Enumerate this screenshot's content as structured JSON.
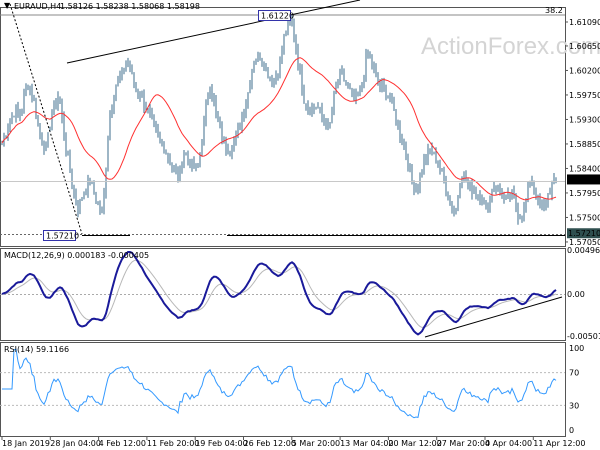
{
  "header": {
    "symbol": "EURAUD,H4",
    "ohlc": "1.58126 1.58238 1.58068 1.58198"
  },
  "watermark": "ActionForex.com",
  "colors": {
    "bars": "#3d6d8c",
    "ma": "#ff3030",
    "macd": "#1a1a9a",
    "signal": "#b8b8b8",
    "rsi": "#3399ff"
  },
  "annotations": {
    "high_label": "1.61220",
    "low_label": "1.57210",
    "fib_label": "38.2"
  },
  "chart_data": [
    {
      "type": "line",
      "title": "EURAUD,H4",
      "subtitle": "price bars with moving average",
      "ylim": [
        1.5695,
        1.613
      ],
      "yticks": [
        "1.61090",
        "1.60650",
        "1.60200",
        "1.59750",
        "1.59300",
        "1.58850",
        "1.58400",
        "1.57950",
        "1.57500",
        "1.57050"
      ],
      "current_price": "1.58198",
      "support_price": "1.57210",
      "close": [
        1.5887,
        1.592,
        1.5947,
        1.5938,
        1.6002,
        1.5966,
        1.5901,
        1.5874,
        1.5947,
        1.5975,
        1.5892,
        1.5819,
        1.5764,
        1.58,
        1.5819,
        1.5782,
        1.5755,
        1.5929,
        1.5993,
        1.6012,
        1.6039,
        1.5993,
        1.5975,
        1.5947,
        1.592,
        1.5892,
        1.5874,
        1.5846,
        1.5819,
        1.5874,
        1.5846,
        1.5837,
        1.5911,
        1.6002,
        1.5938,
        1.5892,
        1.5874,
        1.5892,
        1.5929,
        1.5975,
        1.6039,
        1.6048,
        1.6021,
        1.6002,
        1.6021,
        1.6094,
        1.6113,
        1.6039,
        1.5966,
        1.5947,
        1.5956,
        1.5929,
        1.5911,
        1.5993,
        1.6012,
        1.5984,
        1.5966,
        1.5975,
        1.6057,
        1.6021,
        1.5993,
        1.5984,
        1.5956,
        1.5911,
        1.5874,
        1.5819,
        1.58,
        1.5855,
        1.5874,
        1.5855,
        1.5828,
        1.5782,
        1.5755,
        1.5837,
        1.5809,
        1.58,
        1.5791,
        1.5764,
        1.5809,
        1.58,
        1.5782,
        1.5791,
        1.5755,
        1.5764,
        1.5828,
        1.5782,
        1.5764,
        1.58,
        1.582
      ]
    },
    {
      "type": "line",
      "title": "MACD(12,26,9) 0.000183 -0.000405",
      "ylim": [
        -0.005013,
        0.004965
      ],
      "yticks": [
        "0.004965",
        "0.00",
        "-0.005013"
      ]
    },
    {
      "type": "line",
      "title": "RSI(14) 59.1166",
      "ylim": [
        0,
        100
      ],
      "yticks": [
        "100",
        "70",
        "30",
        "0"
      ]
    }
  ],
  "xaxis": {
    "ticks": [
      "18 Jan 2019",
      "28 Jan 04:00",
      "4 Feb 12:00",
      "11 Feb 20:00",
      "19 Feb 04:00",
      "26 Feb 12:00",
      "5 Mar 20:00",
      "13 Mar 04:00",
      "20 Mar 12:00",
      "27 Mar 20:00",
      "4 Apr 04:00",
      "11 Apr 12:00"
    ]
  }
}
